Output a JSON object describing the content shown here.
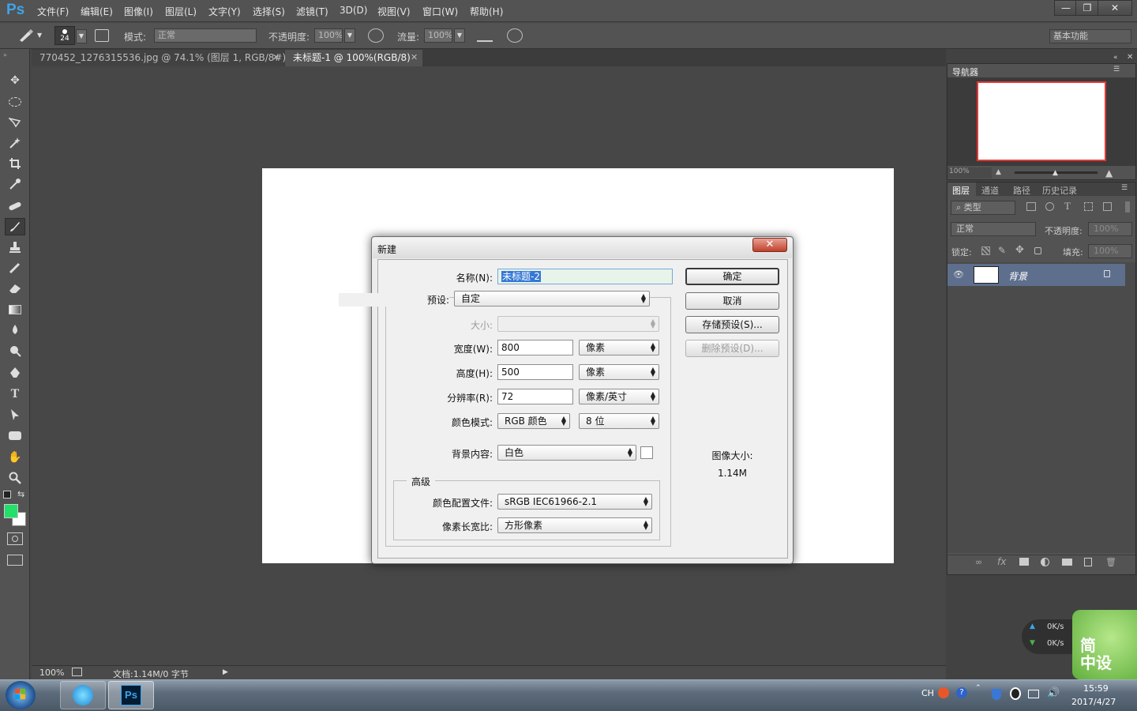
{
  "app": {
    "logo": "Ps",
    "menu": [
      "文件(F)",
      "编辑(E)",
      "图像(I)",
      "图层(L)",
      "文字(Y)",
      "选择(S)",
      "滤镜(T)",
      "3D(D)",
      "视图(V)",
      "窗口(W)",
      "帮助(H)"
    ],
    "window_buttons": [
      "—",
      "❐",
      "✕"
    ]
  },
  "options_bar": {
    "brush_size": "24",
    "mode_label": "模式:",
    "mode_value": "正常",
    "opacity_label": "不透明度:",
    "opacity_value": "100%",
    "flow_label": "流量:",
    "flow_value": "100%",
    "workspace": "基本功能"
  },
  "tabs": [
    {
      "label": "770452_1276315536.jpg @ 74.1% (图层 1, RGB/8#) *",
      "active": false
    },
    {
      "label": "未标题-1 @ 100%(RGB/8)",
      "active": true
    }
  ],
  "tools": [
    "move-tool",
    "elliptical-marquee-tool",
    "polygonal-lasso-tool",
    "magic-wand-tool",
    "crop-tool",
    "eyedropper-tool",
    "healing-brush-tool",
    "brush-tool",
    "clone-stamp-tool",
    "history-brush-tool",
    "eraser-tool",
    "gradient-tool",
    "blur-tool",
    "dodge-tool",
    "pen-tool",
    "type-tool",
    "path-selection-tool",
    "rectangle-tool",
    "hand-tool",
    "zoom-tool"
  ],
  "colors": {
    "foreground": "#22e06a",
    "background": "#ffffff",
    "ps_blue": "#3ea3e9",
    "nav_view_box": "#e53935",
    "layer_selected": "#5d6f8c"
  },
  "status": {
    "zoom": "100%",
    "doc_info": "文档:1.14M/0 字节"
  },
  "navigator": {
    "title": "导航器",
    "zoom": "100%"
  },
  "layers_panel": {
    "tabs": [
      "图层",
      "通道",
      "路径",
      "历史记录"
    ],
    "filter_kind": "类型",
    "blend_mode": "正常",
    "opacity_label": "不透明度:",
    "opacity_value": "100%",
    "lock_label": "锁定:",
    "fill_label": "填充:",
    "fill_value": "100%",
    "layer_name": "背景"
  },
  "dialog": {
    "title": "新建",
    "name_label": "名称(N):",
    "name_value": "未标题-2",
    "preset_label": "预设:",
    "preset_value": "自定",
    "size_label": "大小:",
    "width_label": "宽度(W):",
    "width_value": "800",
    "width_unit": "像素",
    "height_label": "高度(H):",
    "height_value": "500",
    "height_unit": "像素",
    "resolution_label": "分辨率(R):",
    "resolution_value": "72",
    "resolution_unit": "像素/英寸",
    "color_mode_label": "颜色模式:",
    "color_mode_value": "RGB 颜色",
    "bit_depth": "8 位",
    "bg_label": "背景内容:",
    "bg_value": "白色",
    "advanced_label": "高级",
    "profile_label": "颜色配置文件:",
    "profile_value": "sRGB IEC61966-2.1",
    "aspect_label": "像素长宽比:",
    "aspect_value": "方形像素",
    "ok_button": "确定",
    "cancel_button": "取消",
    "save_preset_button": "存储预设(S)...",
    "delete_preset_button": "删除预设(D)...",
    "image_size_label": "图像大小:",
    "image_size_value": "1.14M"
  },
  "net_widget": {
    "up": "0K/s",
    "down": "0K/s",
    "logo_line1": "简",
    "logo_line2": "中设"
  },
  "taskbar": {
    "lang": "CH",
    "time": "15:59",
    "date": "2017/4/27",
    "ps_label": "Ps"
  }
}
